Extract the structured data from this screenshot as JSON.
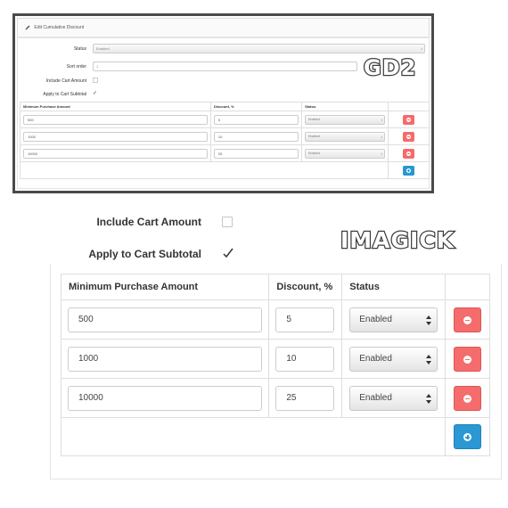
{
  "gd2": {
    "label": "GD2",
    "panel_title": "Edit Cumulative Discount",
    "fields": {
      "status_label": "Status",
      "status_value": "Enabled",
      "sort_order_label": "Sort order",
      "sort_order_value": "1",
      "include_cart_amount_label": "Include Cart Amount",
      "apply_to_subtotal_label": "Apply to Cart Subtotal"
    },
    "table": {
      "headers": [
        "Minimum Purchase Amount",
        "Discount, %",
        "Status"
      ],
      "rows": [
        {
          "amount": "500",
          "discount": "5",
          "status": "Enabled"
        },
        {
          "amount": "1000",
          "discount": "10",
          "status": "Enabled"
        },
        {
          "amount": "10000",
          "discount": "25",
          "status": "Enabled"
        }
      ]
    }
  },
  "imagick": {
    "label": "IMAGICK",
    "include_cart_amount_label": "Include Cart Amount",
    "include_cart_amount_checked": false,
    "apply_to_subtotal_label": "Apply to Cart Subtotal",
    "apply_to_subtotal_checked": true,
    "table": {
      "headers": [
        "Minimum Purchase Amount",
        "Discount, %",
        "Status"
      ],
      "rows": [
        {
          "amount": "500",
          "discount": "5",
          "status": "Enabled"
        },
        {
          "amount": "1000",
          "discount": "10",
          "status": "Enabled"
        },
        {
          "amount": "10000",
          "discount": "25",
          "status": "Enabled"
        }
      ]
    }
  },
  "colors": {
    "remove_button": "#f46c6c",
    "add_button": "#2b97d3",
    "frame": "#4a4a4a"
  },
  "icons": {
    "edit": "pencil-icon",
    "remove": "minus-circle-icon",
    "add": "plus-circle-icon",
    "select_arrows": "up-down-arrows-icon",
    "check": "checkmark-icon"
  }
}
